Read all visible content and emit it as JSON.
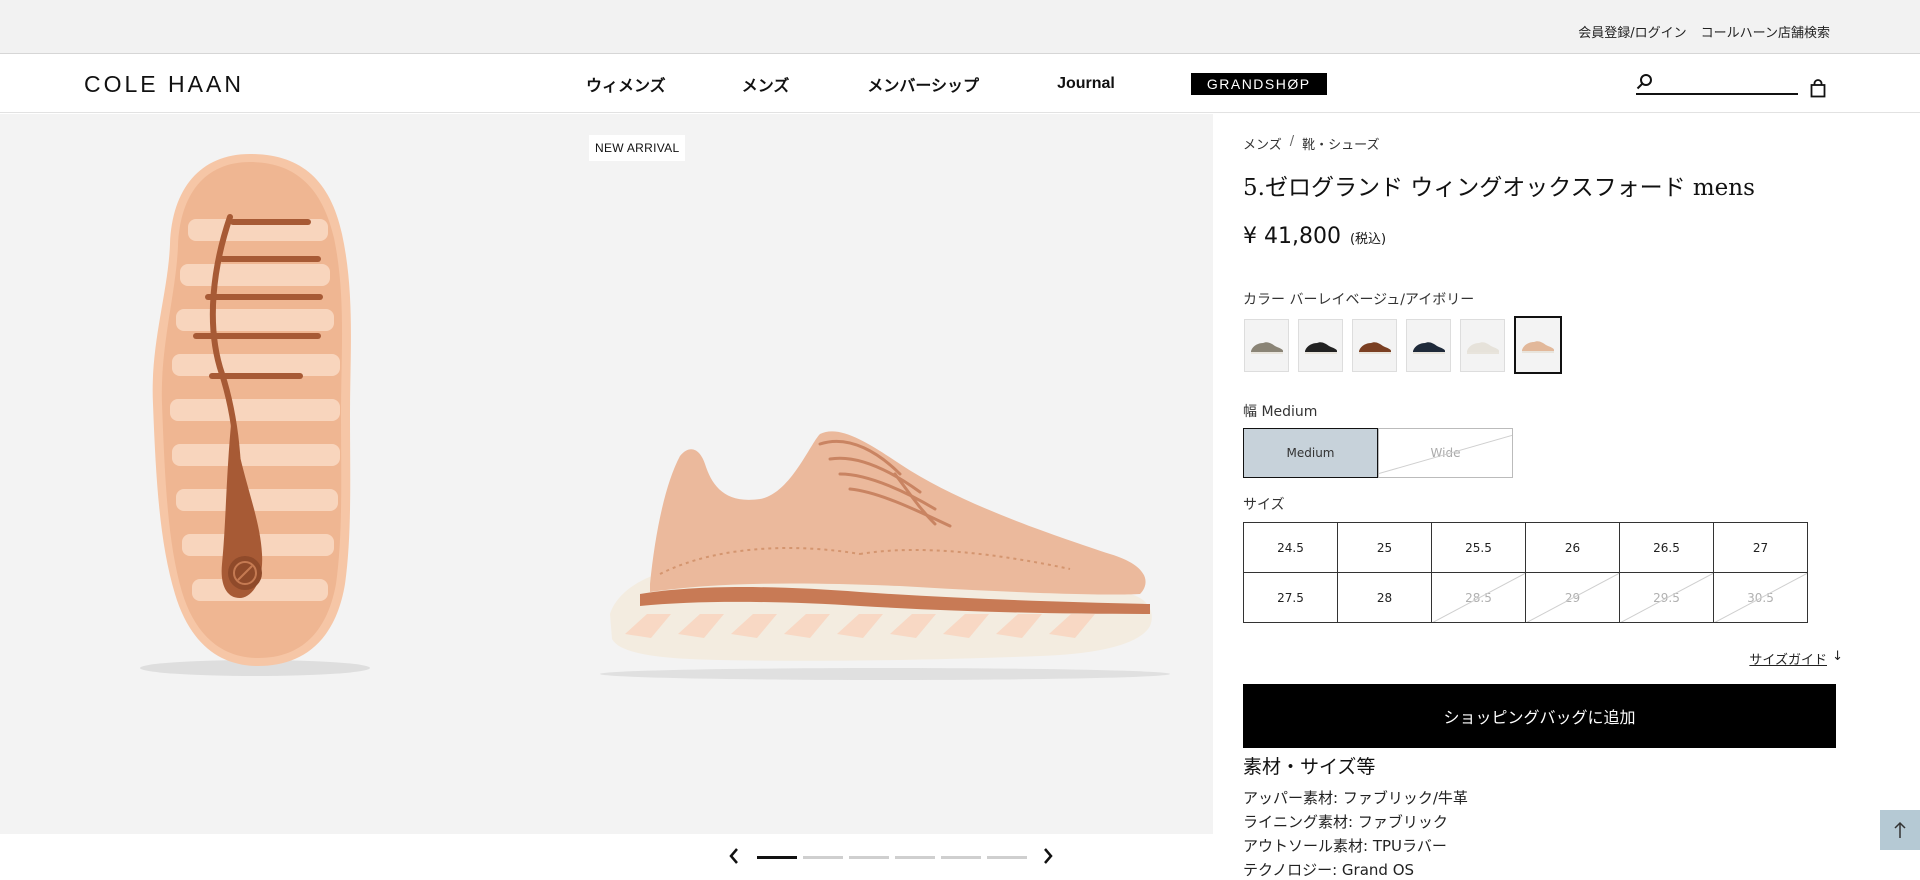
{
  "utility": {
    "login": "会員登録/ログイン",
    "store_search": "コールハーン店舗検索"
  },
  "header": {
    "logo": "COLE HAAN",
    "nav": [
      "ウィメンズ",
      "メンズ",
      "メンバーシップ",
      "Journal"
    ],
    "grandshop": "GRANDSHØP",
    "search_placeholder": ""
  },
  "gallery": {
    "badge": "NEW ARRIVAL",
    "slide_count": 6,
    "active_slide": 1
  },
  "product": {
    "breadcrumb": [
      "メンズ",
      "/",
      "靴・シューズ"
    ],
    "title": "5.ゼログランド ウィングオックスフォード mens",
    "price": "¥ 41,800",
    "price_note": "(税込)",
    "color_label": "カラー バーレイベージュ/アイボリー",
    "swatches": [
      {
        "color": "#8a8476",
        "selected": false
      },
      {
        "color": "#222222",
        "selected": false
      },
      {
        "color": "#7a3f22",
        "selected": false
      },
      {
        "color": "#1f2a3a",
        "selected": false
      },
      {
        "color": "#e6e2da",
        "selected": false
      },
      {
        "color": "#e2b89a",
        "selected": true
      }
    ],
    "width_label": "幅 Medium",
    "widths": [
      {
        "label": "Medium",
        "selected": true,
        "available": true
      },
      {
        "label": "Wide",
        "selected": false,
        "available": false
      }
    ],
    "size_label": "サイズ",
    "sizes": [
      {
        "label": "24.5",
        "available": true
      },
      {
        "label": "25",
        "available": true
      },
      {
        "label": "25.5",
        "available": true
      },
      {
        "label": "26",
        "available": true
      },
      {
        "label": "26.5",
        "available": true
      },
      {
        "label": "27",
        "available": true
      },
      {
        "label": "27.5",
        "available": true
      },
      {
        "label": "28",
        "available": true
      },
      {
        "label": "28.5",
        "available": false
      },
      {
        "label": "29",
        "available": false
      },
      {
        "label": "29.5",
        "available": false
      },
      {
        "label": "30.5",
        "available": false
      }
    ],
    "size_guide": "サイズガイド",
    "size_guide_arrow": "↓",
    "add_to_bag": "ショッピングバッグに追加",
    "materials_title": "素材・サイズ等",
    "materials": [
      "アッパー素材: ファブリック/牛革",
      "ライニング素材: ファブリック",
      "アウトソール素材: TPUラバー",
      "テクノロジー: Grand OS"
    ]
  }
}
